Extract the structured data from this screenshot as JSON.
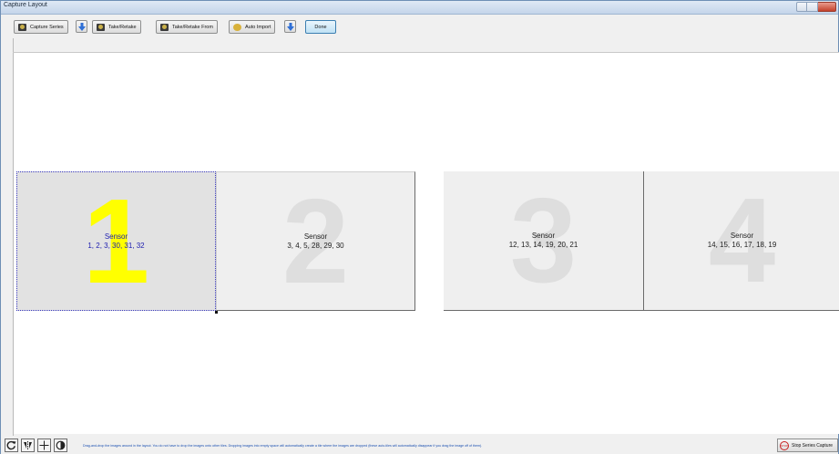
{
  "window": {
    "title": "Capture Layout"
  },
  "toolbar": {
    "capture_series": "Capture Series",
    "take_retake": "Take/Retake",
    "take_retake_from": "Take/Retake From",
    "auto_import": "Auto Import",
    "done": "Done"
  },
  "tiles": [
    {
      "number": "1",
      "title": "Sensor",
      "sensors": "1, 2, 3, 30, 31, 32",
      "selected": true
    },
    {
      "number": "2",
      "title": "Sensor",
      "sensors": "3, 4, 5, 28, 29, 30",
      "selected": false
    },
    {
      "number": "3",
      "title": "Sensor",
      "sensors": "12, 13, 14, 19, 20, 21",
      "selected": false
    },
    {
      "number": "4",
      "title": "Sensor",
      "sensors": "14, 15, 16, 17, 18, 19",
      "selected": false
    }
  ],
  "status": {
    "help_text": "Drag-and-drop the images around in the layout.  You do not have to drop the images onto other tiles.  Dropping images into empty space will automatically create a tile where the images are dropped (these auto-tiles will automatically disappear if you drag the image off of them).",
    "stop_icon_text": "STOP",
    "stop_button": "Stop Series Capture"
  },
  "colors": {
    "selected_number": "#ffff00",
    "selected_text": "#2020b0",
    "ghost_number": "#dedede"
  },
  "icons": [
    "camera-icon",
    "dropdown-arrow-icon",
    "gear-icon",
    "rotate-icon",
    "flip-horizontal-icon",
    "crosshair-icon",
    "contrast-icon",
    "stop-icon"
  ]
}
